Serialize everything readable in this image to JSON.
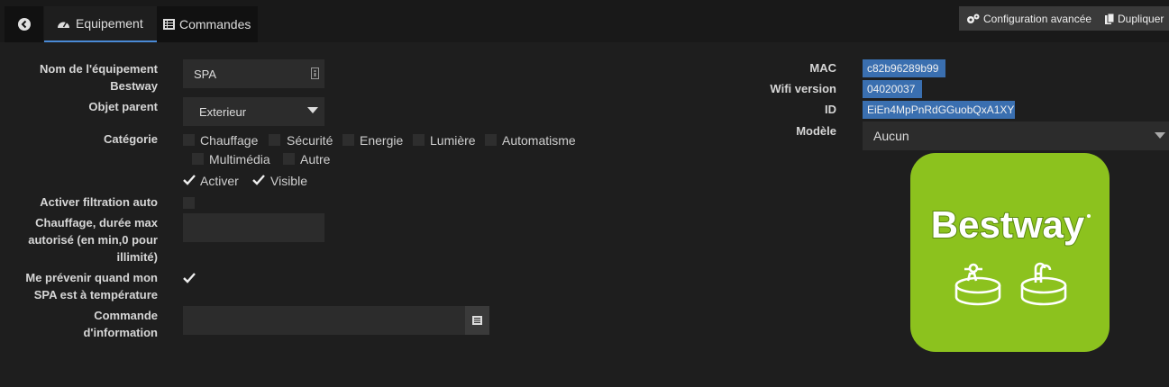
{
  "tabs": {
    "equipement": "Equipement",
    "commandes": "Commandes"
  },
  "toolbar": {
    "advanced": "Configuration avancée",
    "duplicate": "Dupliquer"
  },
  "form": {
    "name_label": "Nom de l'équipement Bestway",
    "name_value": "SPA",
    "parent_label": "Objet parent",
    "parent_value": "Exterieur",
    "category_label": "Catégorie",
    "categories": [
      "Chauffage",
      "Sécurité",
      "Energie",
      "Lumière",
      "Automatisme",
      "Multimédia",
      "Autre"
    ],
    "activate": "Activer",
    "visible": "Visible",
    "filtration_label": "Activer filtration auto",
    "heating_label": "Chauffage, durée max autorisé (en min,0 pour illimité)",
    "heating_value": "",
    "notify_label": "Me prévenir quand mon SPA est à température",
    "info_cmd_label": "Commande d'information",
    "info_cmd_value": ""
  },
  "details": {
    "mac_label": "MAC",
    "mac_value": "c82b96289b99",
    "wifi_label": "Wifi version",
    "wifi_value": "04020037",
    "id_label": "ID",
    "id_value": "EiEn4MpPnRdGGuobQxA1XY",
    "model_label": "Modèle",
    "model_value": "Aucun"
  },
  "logo": {
    "text": "Bestway",
    "color": "#8cc21e"
  }
}
